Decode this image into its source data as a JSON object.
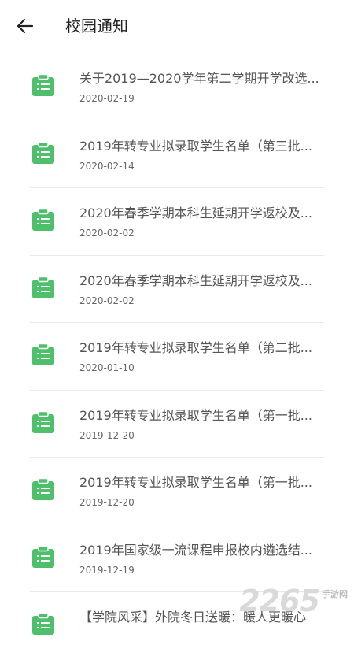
{
  "header": {
    "title": "校园通知"
  },
  "theme": {
    "accent": "#4ec06b",
    "icon_name": "clipboard-list-icon"
  },
  "notices": [
    {
      "title": "关于2019—2020学年第二学期开学改选...",
      "date": "2020-02-19"
    },
    {
      "title": "2019年转专业拟录取学生名单（第三批...",
      "date": "2020-02-14"
    },
    {
      "title": "2020年春季学期本科生延期开学返校及...",
      "date": "2020-02-02"
    },
    {
      "title": "2020年春季学期本科生延期开学返校及...",
      "date": "2020-02-02"
    },
    {
      "title": "2019年转专业拟录取学生名单（第二批...",
      "date": "2020-01-10"
    },
    {
      "title": "2019年转专业拟录取学生名单（第一批...",
      "date": "2019-12-20"
    },
    {
      "title": "2019年转专业拟录取学生名单（第一批...",
      "date": "2019-12-20"
    },
    {
      "title": "2019年国家级一流课程申报校内遴选结...",
      "date": "2019-12-19"
    },
    {
      "title": "【学院风采】外院冬日送暖：暖人更暖心",
      "date": ""
    }
  ],
  "watermark": {
    "number": "2265",
    "suffix": "手游网"
  }
}
